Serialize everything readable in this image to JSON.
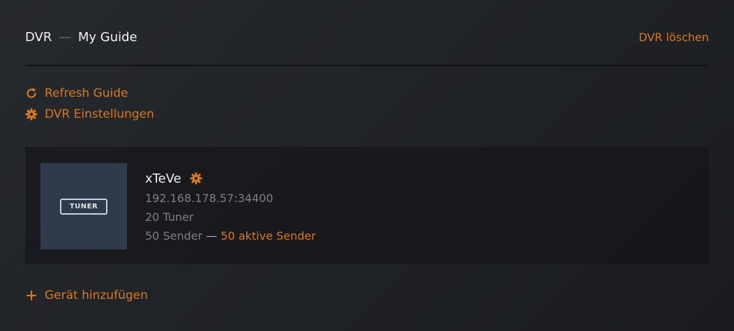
{
  "header": {
    "title_part1": "DVR",
    "title_sep": "—",
    "title_part2": "My Guide",
    "delete_label": "DVR löschen"
  },
  "actions": {
    "refresh_label": "Refresh Guide",
    "settings_label": "DVR Einstellungen",
    "add_device_label": "Gerät hinzufügen"
  },
  "device": {
    "thumb_label": "TUNER",
    "name": "xTeVe",
    "address": "192.168.178.57:34400",
    "tuners": "20 Tuner",
    "channels": "50 Sender",
    "channels_sep": "—",
    "active_channels": "50 aktive Sender"
  },
  "colors": {
    "accent": "#d9791c",
    "background": "#202328",
    "thumb_bg": "#2f3b4a"
  },
  "icons": {
    "refresh": "refresh-icon",
    "settings": "gear-icon",
    "add": "plus-icon"
  }
}
